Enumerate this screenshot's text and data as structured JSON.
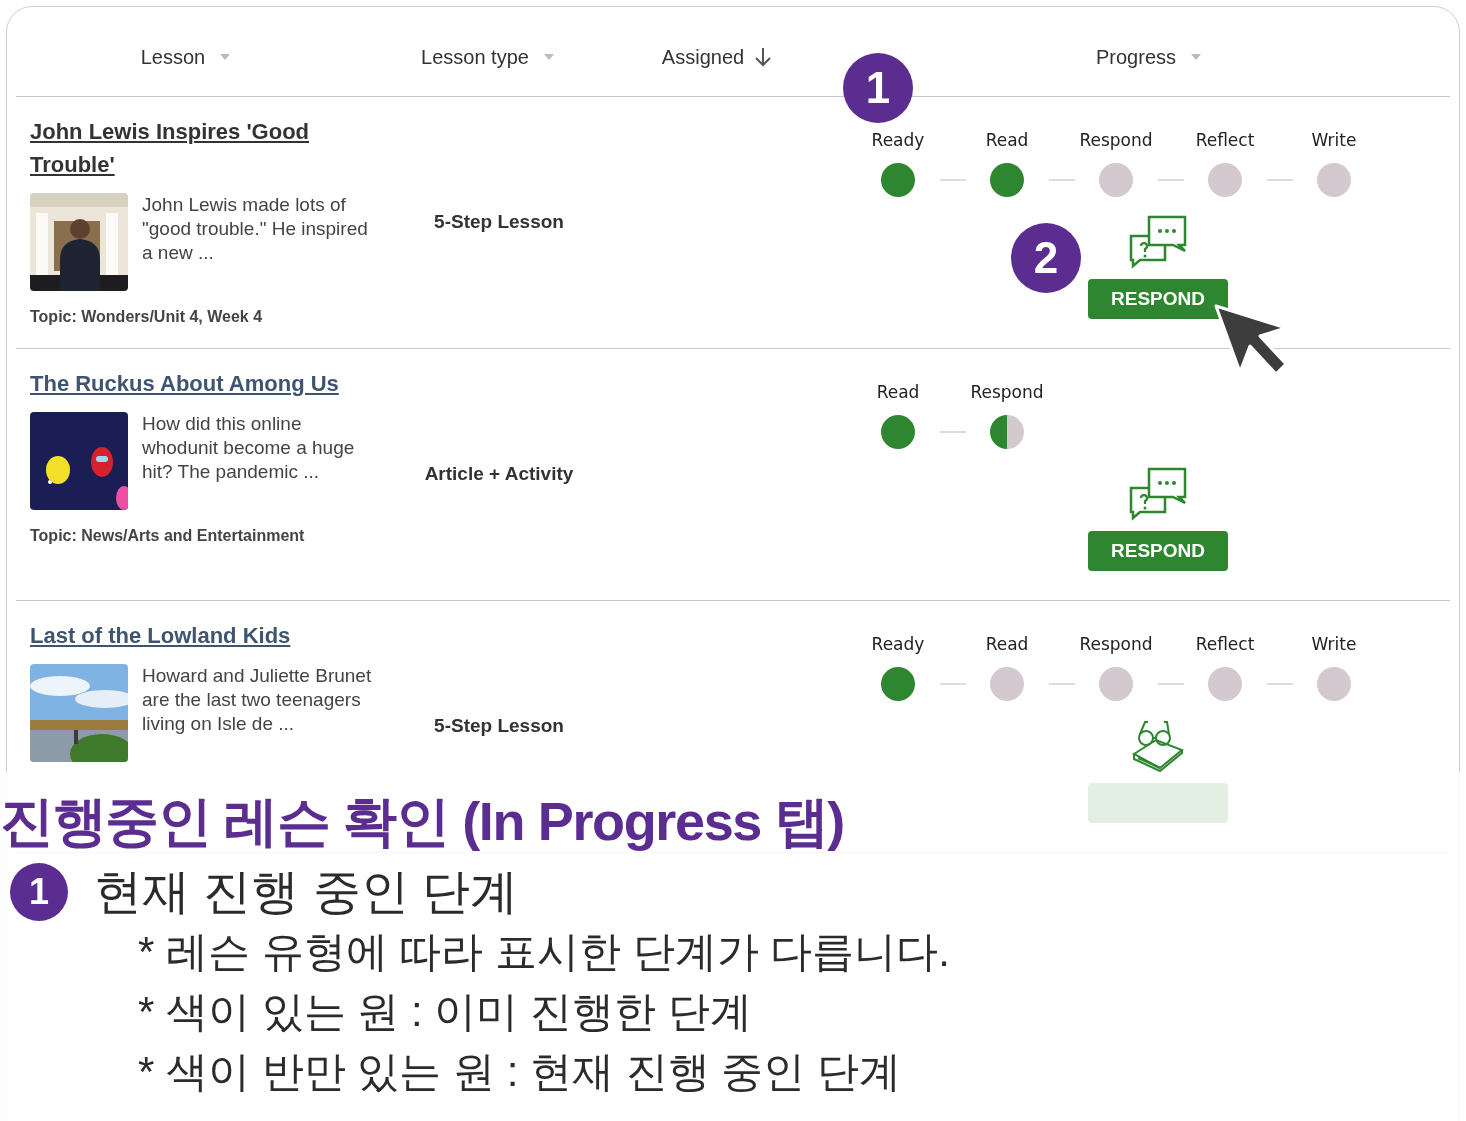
{
  "columns": [
    {
      "label": "Lesson",
      "kind": "caret"
    },
    {
      "label": "Lesson type",
      "kind": "caret"
    },
    {
      "label": "Assigned",
      "kind": "arrow"
    },
    {
      "label": "Progress",
      "kind": "caret"
    }
  ],
  "lessons": [
    {
      "title": "John Lewis Inspires 'Good Trouble'",
      "visited": true,
      "description": "John Lewis made lots of \"good trouble.\" He inspired a new ...",
      "topic": "Topic: Wonders/Unit 4, Week 4",
      "lesson_type": "5-Step Lesson",
      "steps": [
        {
          "label": "Ready",
          "done": true,
          "current": false
        },
        {
          "label": "Read",
          "done": true,
          "current": false
        },
        {
          "label": "Respond",
          "done": false,
          "current": false
        },
        {
          "label": "Reflect",
          "done": false,
          "current": false
        },
        {
          "label": "Write",
          "done": false,
          "current": false
        }
      ],
      "action": {
        "label": "RESPOND",
        "kind": "chat"
      }
    },
    {
      "title": "The Ruckus About Among Us",
      "visited": false,
      "description": "How did this online whodunit become a huge hit? The pandemic ...",
      "topic": "Topic: News/Arts and Entertainment",
      "lesson_type": "Article + Activity",
      "steps": [
        {
          "label": "Read",
          "done": true,
          "current": false
        },
        {
          "label": "Respond",
          "done": false,
          "current": true
        }
      ],
      "action": {
        "label": "RESPOND",
        "kind": "chat"
      }
    },
    {
      "title": "Last of the Lowland Kids",
      "visited": false,
      "description": "Howard and Juliette Brunet are the last two teenagers living on Isle de ...",
      "lesson_type": "5-Step Lesson",
      "steps": [
        {
          "label": "Ready",
          "done": true,
          "current": false
        },
        {
          "label": "Read",
          "done": false,
          "current": false
        },
        {
          "label": "Respond",
          "done": false,
          "current": false
        },
        {
          "label": "Reflect",
          "done": false,
          "current": false
        },
        {
          "label": "Write",
          "done": false,
          "current": false
        }
      ],
      "action": {
        "kind": "book"
      }
    }
  ],
  "callouts": [
    {
      "number": "1"
    },
    {
      "number": "2"
    }
  ],
  "annotation": {
    "title": "진행중인 레슨 확인 (In Progress 탭)",
    "badge": "1",
    "heading": "현재 진행 중인 단계",
    "notes": [
      "* 레슨 유형에 따라 표시한 단계가 다릅니다.",
      "* 색이 있는 원 : 이미 진행한 단계",
      "* 색이 반만 있는 원 : 현재 진행 중인 단계"
    ]
  }
}
